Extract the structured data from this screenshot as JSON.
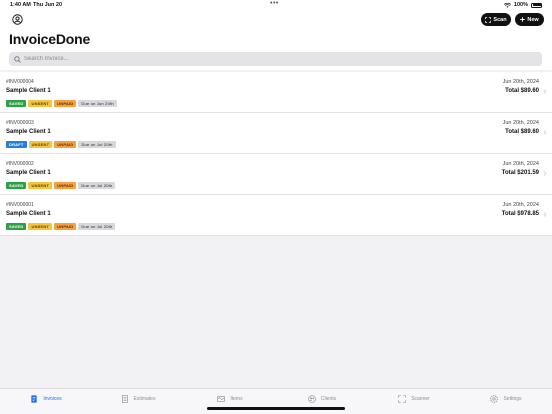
{
  "status": {
    "time": "1:40 AM",
    "date": "Thu Jun 20",
    "battery": "100%"
  },
  "header": {
    "title": "InvoiceDone",
    "scan_label": "Scan",
    "new_label": "New",
    "search_placeholder": "Search Invoice..."
  },
  "invoices": [
    {
      "number": "#INV000004",
      "client": "Sample Client 1",
      "date": "Jun 20th, 2024",
      "total": "Total $89.60",
      "badges": [
        {
          "label": "SAVED",
          "kind": "saved"
        },
        {
          "label": "UNSENT",
          "kind": "unsent"
        },
        {
          "label": "UNPAID",
          "kind": "unpaid"
        },
        {
          "label": "Due on Jun 20th",
          "kind": "due"
        }
      ]
    },
    {
      "number": "#INV000003",
      "client": "Sample Client 1",
      "date": "Jun 20th, 2024",
      "total": "Total $89.60",
      "badges": [
        {
          "label": "DRAFT",
          "kind": "draft"
        },
        {
          "label": "UNSENT",
          "kind": "unsent"
        },
        {
          "label": "UNPAID",
          "kind": "unpaid"
        },
        {
          "label": "Due on Jul 20th",
          "kind": "due"
        }
      ]
    },
    {
      "number": "#INV000002",
      "client": "Sample Client 1",
      "date": "Jun 20th, 2024",
      "total": "Total $201.59",
      "badges": [
        {
          "label": "SAVED",
          "kind": "saved"
        },
        {
          "label": "UNSENT",
          "kind": "unsent"
        },
        {
          "label": "UNPAID",
          "kind": "unpaid"
        },
        {
          "label": "Due on Jul 20th",
          "kind": "due"
        }
      ]
    },
    {
      "number": "#INV000001",
      "client": "Sample Client 1",
      "date": "Jun 20th, 2024",
      "total": "Total $978.85",
      "badges": [
        {
          "label": "SAVED",
          "kind": "saved"
        },
        {
          "label": "UNSENT",
          "kind": "unsent"
        },
        {
          "label": "UNPAID",
          "kind": "unpaid"
        },
        {
          "label": "Due on Jul 20th",
          "kind": "due"
        }
      ]
    }
  ],
  "tabs": [
    {
      "label": "Invoices",
      "icon": "invoice-icon",
      "active": true
    },
    {
      "label": "Estimates",
      "icon": "estimate-icon",
      "active": false
    },
    {
      "label": "Items",
      "icon": "items-icon",
      "active": false
    },
    {
      "label": "Clients",
      "icon": "clients-icon",
      "active": false
    },
    {
      "label": "Scanner",
      "icon": "scanner-icon",
      "active": false
    },
    {
      "label": "Settings",
      "icon": "settings-icon",
      "active": false
    }
  ],
  "colors": {
    "accent": "#1f6fe0",
    "saved": "#2ea043",
    "draft": "#2a7fd4",
    "unsent": "#f5c542",
    "unpaid": "#f5a142"
  }
}
